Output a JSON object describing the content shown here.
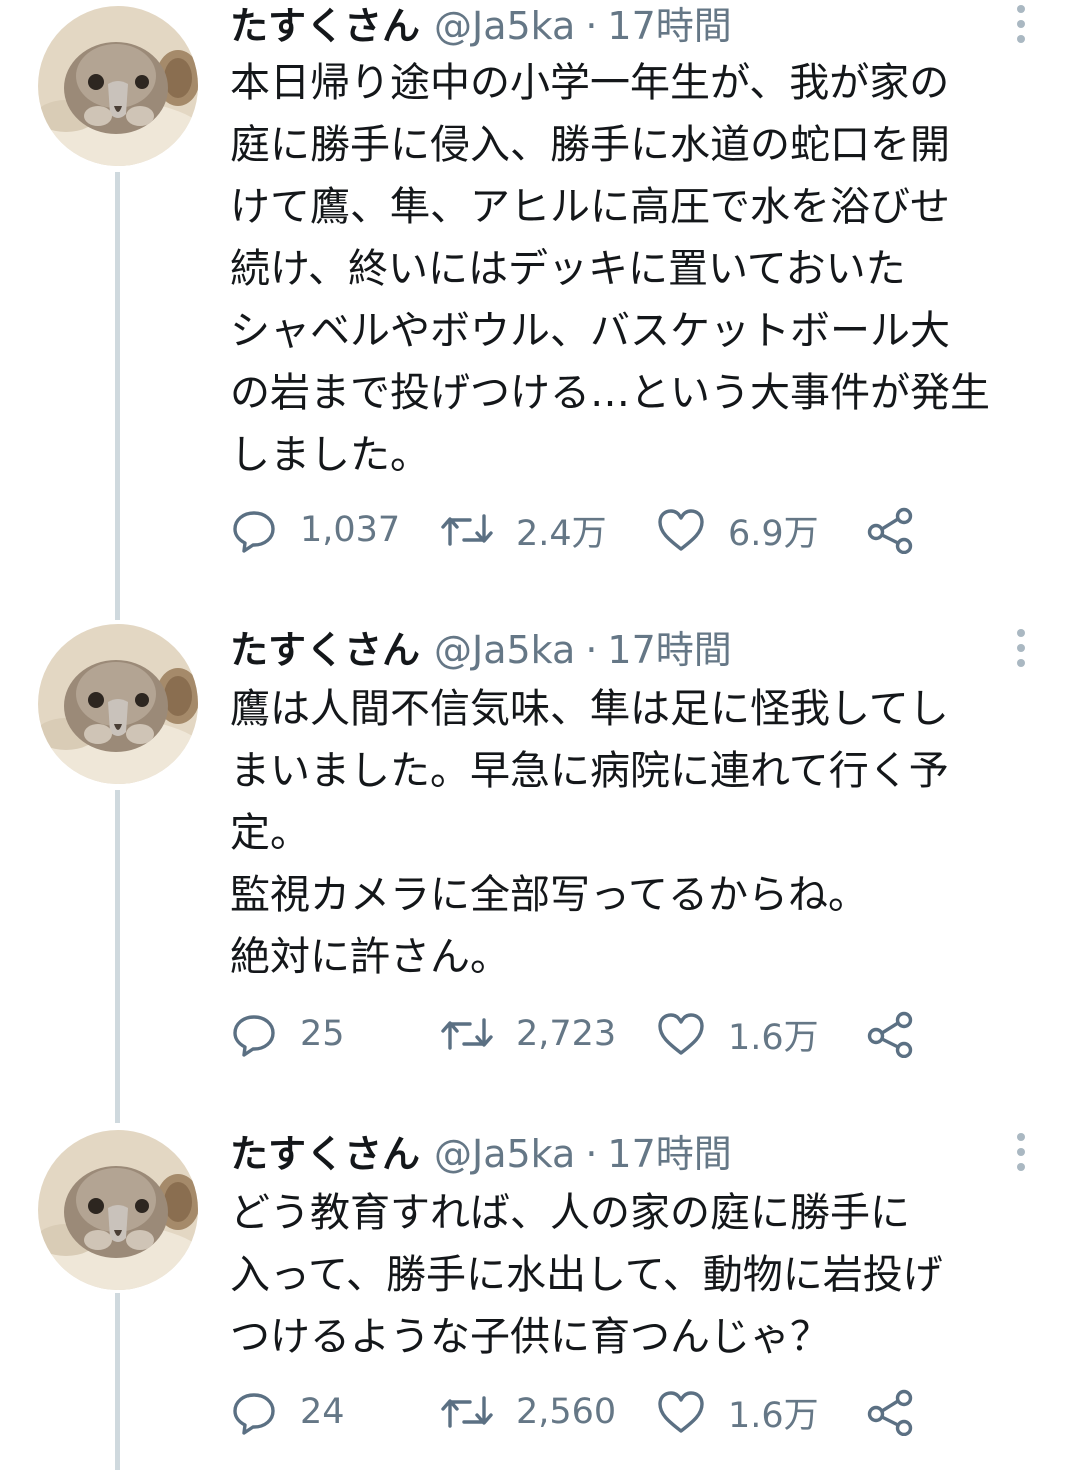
{
  "tweets": [
    {
      "name": "たすくさん",
      "handle": "@Ja5ka",
      "separator": "·",
      "time": "17時間",
      "text": "本日帰り途中の小学一年生が、我が家の\n庭に勝手に侵入、勝手に水道の蛇口を開\nけて鷹、隼、アヒルに高圧で水を浴びせ\n続け、終いにはデッキに置いておいた\nシャベルやボウル、バスケットボール大\nの岩まで投げつける…という大事件が発生\nしました。",
      "reply_count": "1,037",
      "retweet_count": "2.4万",
      "like_count": "6.9万"
    },
    {
      "name": "たすくさん",
      "handle": "@Ja5ka",
      "separator": "·",
      "time": "17時間",
      "text": "鷹は人間不信気味、隼は足に怪我してし\nまいました。早急に病院に連れて行く予\n定。\n監視カメラに全部写ってるからね。\n絶対に許さん。",
      "reply_count": "25",
      "retweet_count": "2,723",
      "like_count": "1.6万"
    },
    {
      "name": "たすくさん",
      "handle": "@Ja5ka",
      "separator": "·",
      "time": "17時間",
      "text": "どう教育すれば、人の家の庭に勝手に\n入って、勝手に水出して、動物に岩投げ\nつけるような子供に育つんじゃ？",
      "reply_count": "24",
      "retweet_count": "2,560",
      "like_count": "1.6万"
    }
  ],
  "icons": {
    "avatar": "bird-avatar",
    "more": "more-vertical-icon",
    "reply": "reply-icon",
    "retweet": "retweet-icon",
    "like": "heart-icon",
    "share": "share-icon"
  },
  "colors": {
    "text": "#14171a",
    "secondary": "#657786",
    "icon": "#5b7083",
    "thread_line": "#cfd9de",
    "more_dots": "#aab8c2"
  }
}
